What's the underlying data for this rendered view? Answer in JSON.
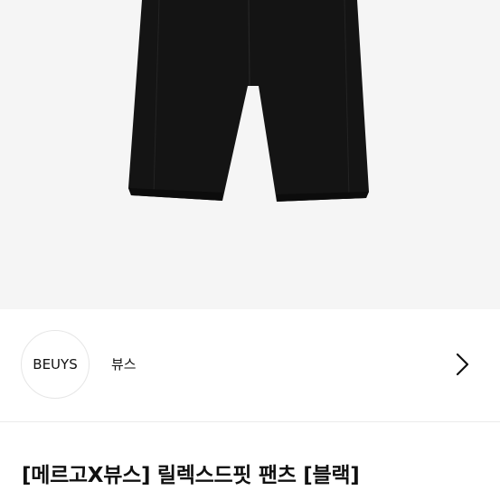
{
  "brand": {
    "logo_text": "BEUYS",
    "name": "뷰스"
  },
  "product": {
    "title": "[메르고X뷰스] 릴렉스드핏 팬츠 [블랙]",
    "image_icon": "black-pants-image"
  },
  "icons": {
    "brand_link": "chevron-right-icon"
  },
  "colors": {
    "hero_background": "#f5f5f5",
    "garment": "#141414",
    "text": "#111111"
  }
}
